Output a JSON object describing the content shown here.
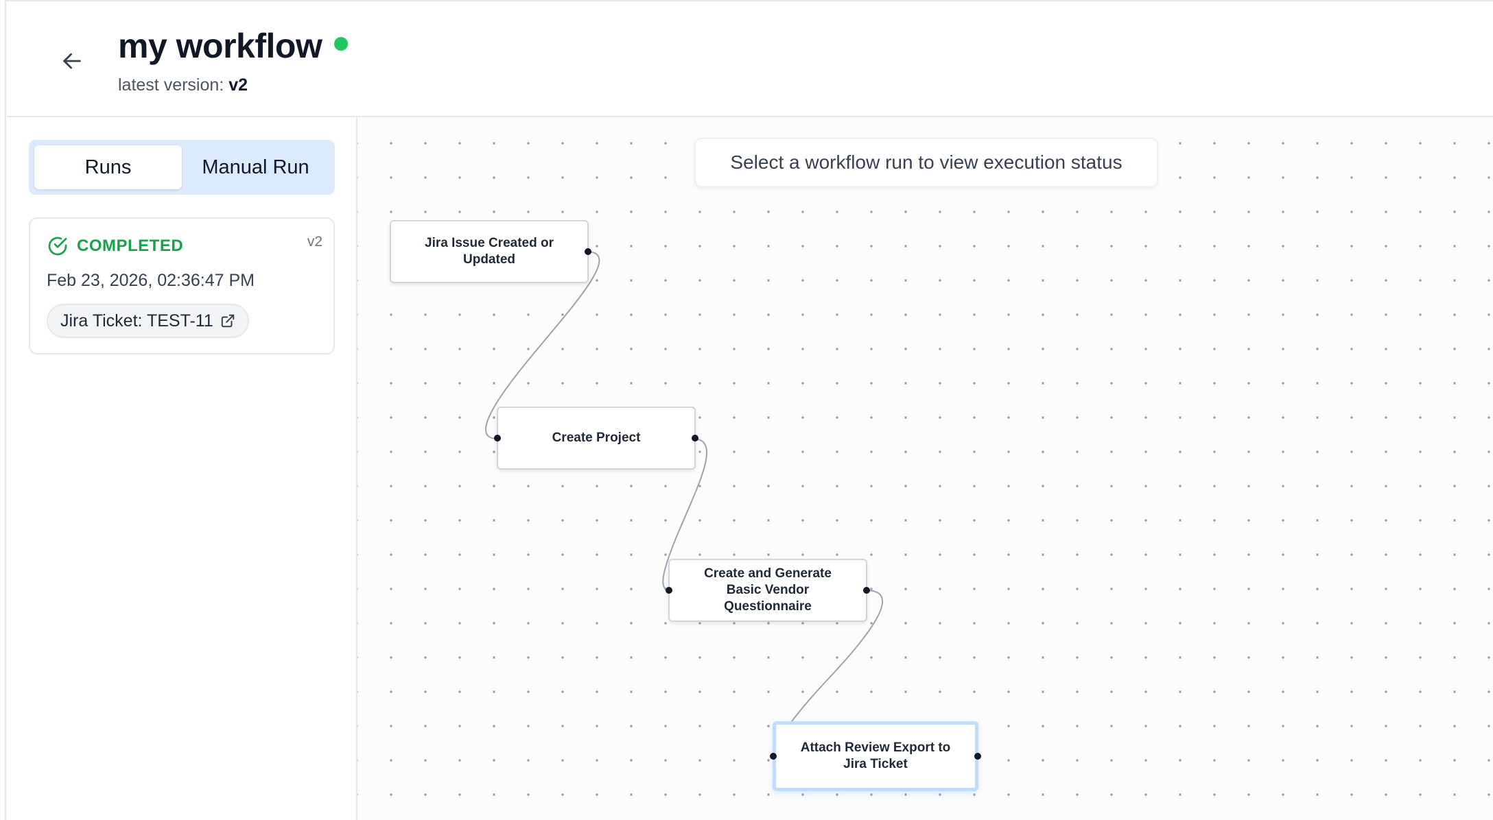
{
  "header": {
    "title": "my workflow",
    "version_label": "latest version:",
    "version_value": "v2",
    "status_color": "#22c55e"
  },
  "sidebar": {
    "tabs": [
      {
        "label": "Runs",
        "active": true
      },
      {
        "label": "Manual Run",
        "active": false
      }
    ],
    "runs": [
      {
        "status": "COMPLETED",
        "status_color": "#16a34a",
        "version": "v2",
        "timestamp": "Feb 23, 2026, 02:36:47 PM",
        "ticket_label": "Jira Ticket: TEST-11",
        "ticket_icon": "external-link-icon"
      }
    ]
  },
  "canvas": {
    "message": "Select a workflow run to view execution status",
    "nodes": [
      {
        "id": "n1",
        "label": "Jira Issue Created or Updated"
      },
      {
        "id": "n2",
        "label": "Create Project"
      },
      {
        "id": "n3",
        "label": "Create and Generate Basic Vendor Questionnaire"
      },
      {
        "id": "n4",
        "label": "Attach Review Export to Jira Ticket",
        "selected": true
      }
    ],
    "edges": [
      {
        "from": "n1",
        "to": "n2"
      },
      {
        "from": "n2",
        "to": "n3"
      },
      {
        "from": "n3",
        "to": "n4"
      }
    ]
  }
}
